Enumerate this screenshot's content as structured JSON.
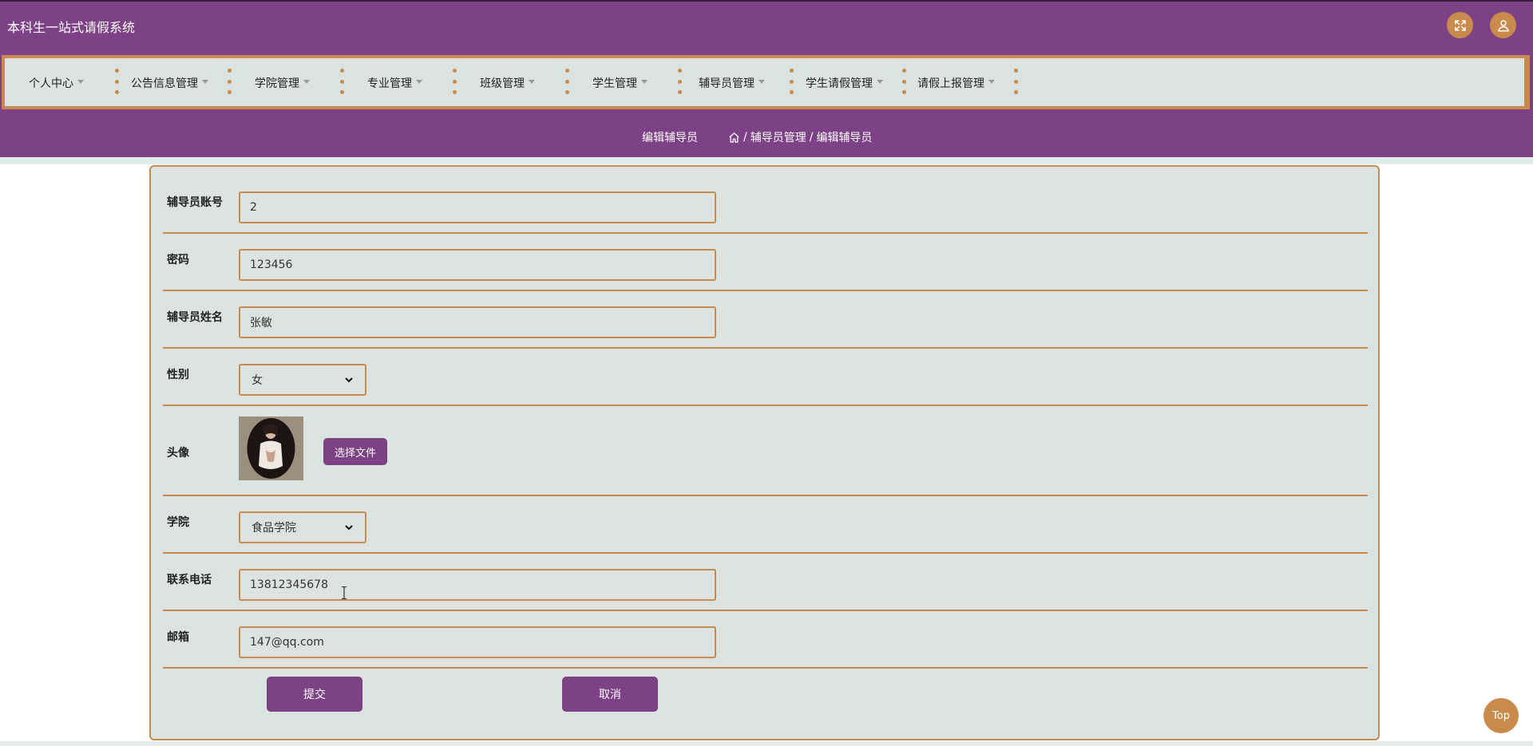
{
  "app": {
    "title": "本科生一站式请假系统"
  },
  "header": {
    "fullscreen_icon": "expand-icon",
    "user_icon": "user-icon"
  },
  "nav": {
    "items": [
      {
        "label": "个人中心"
      },
      {
        "label": "公告信息管理"
      },
      {
        "label": "学院管理"
      },
      {
        "label": "专业管理"
      },
      {
        "label": "班级管理"
      },
      {
        "label": "学生管理"
      },
      {
        "label": "辅导员管理"
      },
      {
        "label": "学生请假管理"
      },
      {
        "label": "请假上报管理"
      }
    ]
  },
  "breadcrumb": {
    "page_title": "编辑辅导员",
    "home_icon": "home-icon",
    "section": "辅导员管理",
    "separator": "/",
    "current": "编辑辅导员"
  },
  "form": {
    "account": {
      "label": "辅导员账号",
      "value": "2"
    },
    "password": {
      "label": "密码",
      "value": "123456"
    },
    "name": {
      "label": "辅导员姓名",
      "value": "张敏"
    },
    "gender": {
      "label": "性别",
      "value": "女"
    },
    "avatar": {
      "label": "头像",
      "upload_label": "选择文件"
    },
    "college": {
      "label": "学院",
      "value": "食品学院"
    },
    "phone": {
      "label": "联系电话",
      "value": "13812345678"
    },
    "email": {
      "label": "邮箱",
      "value": "147@qq.com"
    },
    "submit_label": "提交",
    "cancel_label": "取消"
  },
  "back_to_top": {
    "label": "Top"
  },
  "colors": {
    "primary": "#7d4285",
    "accent": "#c98a4b",
    "panel": "#dbe4e0"
  }
}
